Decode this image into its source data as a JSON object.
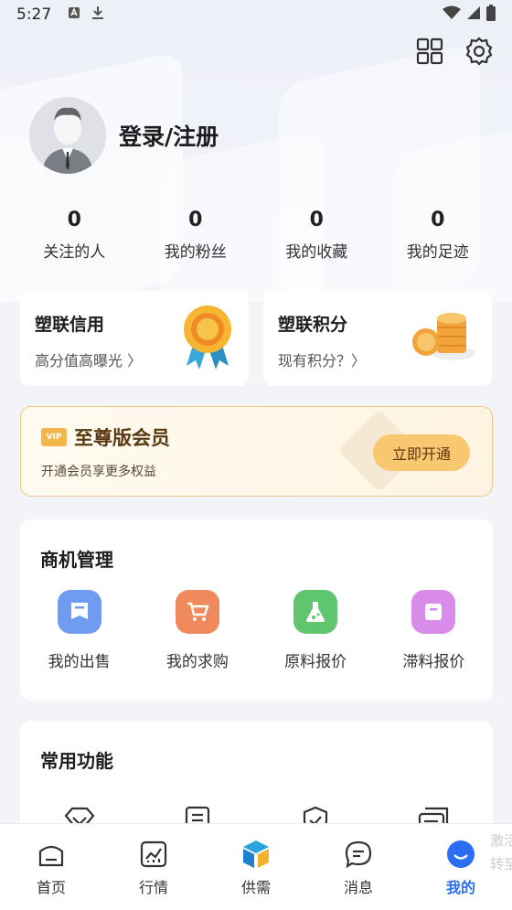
{
  "status_bar": {
    "time": "5:27"
  },
  "profile": {
    "login_label": "登录/注册"
  },
  "stats": [
    {
      "value": "0",
      "label": "关注的人"
    },
    {
      "value": "0",
      "label": "我的粉丝"
    },
    {
      "value": "0",
      "label": "我的收藏"
    },
    {
      "value": "0",
      "label": "我的足迹"
    }
  ],
  "credit_card": {
    "title": "塑联信用",
    "subtitle": "高分值高曝光 〉"
  },
  "points_card": {
    "title": "塑联积分",
    "subtitle": "现有积分？〉"
  },
  "vip": {
    "badge": "VIP",
    "title": "至尊版会员",
    "subtitle": "开通会员享更多权益",
    "button": "立即开通"
  },
  "business": {
    "title": "商机管理",
    "items": [
      {
        "label": "我的出售",
        "color": "#6f9bf0"
      },
      {
        "label": "我的求购",
        "color": "#f08a5d"
      },
      {
        "label": "原料报价",
        "color": "#5fc56f"
      },
      {
        "label": "滞料报价",
        "color": "#d88be8"
      }
    ]
  },
  "common": {
    "title": "常用功能"
  },
  "tabs": [
    {
      "label": "首页"
    },
    {
      "label": "行情"
    },
    {
      "label": "供需"
    },
    {
      "label": "消息"
    },
    {
      "label": "我的"
    }
  ],
  "peek": {
    "line1": "激活",
    "line2": "转至"
  },
  "colors": {
    "accent": "#2b6ef2",
    "vip_button": "#f8c870"
  }
}
